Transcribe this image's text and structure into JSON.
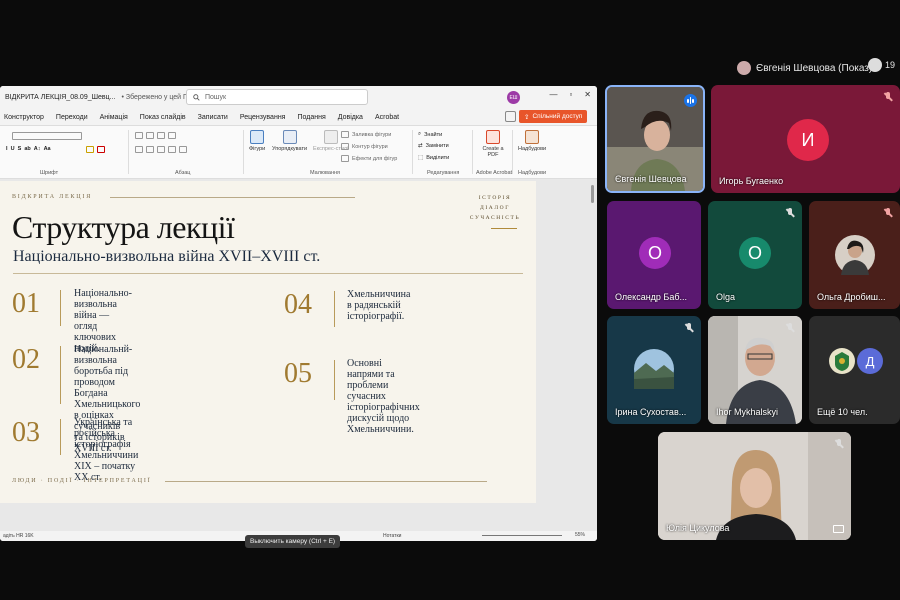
{
  "meet": {
    "presenter_label": "Євгенія Шевцова (Показ)",
    "people_count": "19",
    "tooltip": "Выключить камеру (Ctrl + E)",
    "participants": [
      {
        "name": "Євгенія Шевцова",
        "color": "#3b3b3b"
      },
      {
        "name": "Игорь Бугаенко",
        "initial": "И",
        "color": "#7a1838",
        "avatar_color": "#e0284a"
      },
      {
        "name": "Олександр Баб...",
        "initial": "О",
        "color": "#5a1870",
        "avatar_color": "#a02cb8"
      },
      {
        "name": "Olga",
        "initial": "O",
        "color": "#124a3c",
        "avatar_color": "#178a6c"
      },
      {
        "name": "Ольга Дробиш...",
        "color": "#4a1f1a"
      },
      {
        "name": "Ірина Сухостав...",
        "color": "#173848"
      },
      {
        "name": "Ihor Mykhalskyi",
        "color": "#cfcfcf"
      },
      {
        "name": "Ещё 10 чел.",
        "initial": "Д",
        "color": "#2b2b2b",
        "avatar_color": "#5b6bd8"
      },
      {
        "name": "Юлія Цикулова",
        "color": "#d8d2cc"
      }
    ]
  },
  "ppt": {
    "doc_title": "ВІДКРИТА ЛЕКЦІЯ_08.09_Шевц...",
    "saved_status": "• Збережено у цей ПК ⌵",
    "search_placeholder": "Пошук",
    "user_initials": "ЕШ",
    "tabs": [
      "Конструктор",
      "Переходи",
      "Анімація",
      "Показ слайдів",
      "Записати",
      "Рецензування",
      "Подання",
      "Довідка",
      "Acrobat"
    ],
    "share_label": "Спільний доступ",
    "ribbon": {
      "font_group": "Шрифт",
      "paragraph_group": "Абзац",
      "drawing_group": "Малювання",
      "editing_group": "Редагування",
      "adobe_group": "Adobe Acrobat",
      "addins_group": "Надбудови",
      "shapes": "Фігури",
      "arrange": "Упорядкувати",
      "quick_styles": "Експрес-стилі",
      "shape_fill": "Заливка фігури",
      "shape_outline": "Контур фігури",
      "shape_effects": "Ефекти для фігур",
      "find": "Знайти",
      "replace": "Замінити",
      "select": "Виділити",
      "create_pdf": "Create a PDF",
      "addins": "Надбудови"
    },
    "status_left": "адіть HR 16K",
    "status_notes": "Нотатки",
    "zoom": "55%"
  },
  "slide": {
    "kicker": "ВІДКРИТА ЛЕКЦІЯ",
    "brand": [
      "ІСТОРІЯ",
      "ДІАЛОГ",
      "СУЧАСНІСТЬ"
    ],
    "title": "Структура лекції",
    "subtitle": "Національно-визвольна війна XVII–XVIII ст.",
    "items": [
      {
        "num": "01",
        "text": "Національно-визвольна\nвійна — огляд ключових\nподій."
      },
      {
        "num": "02",
        "text": "Національнй-визвольна\nборотьба під проводом\nБогдана Хмельницького\nв оцінках сучасників\nта істориків XVIII ст."
      },
      {
        "num": "03",
        "text": "Українська та російська\nісторіографія Хмельниччини\nXIX – початку XX ст."
      },
      {
        "num": "04",
        "text": "Хмельниччина\nв радянській\nісторіографії."
      },
      {
        "num": "05",
        "text": "Основні напрями та проблеми\nсучасних історіографічних\nдискусій щодо Хмельниччини."
      }
    ],
    "footer": "ЛЮДИ · ПОДІЇ · ІНТЕРПРЕТАЦІЇ"
  }
}
